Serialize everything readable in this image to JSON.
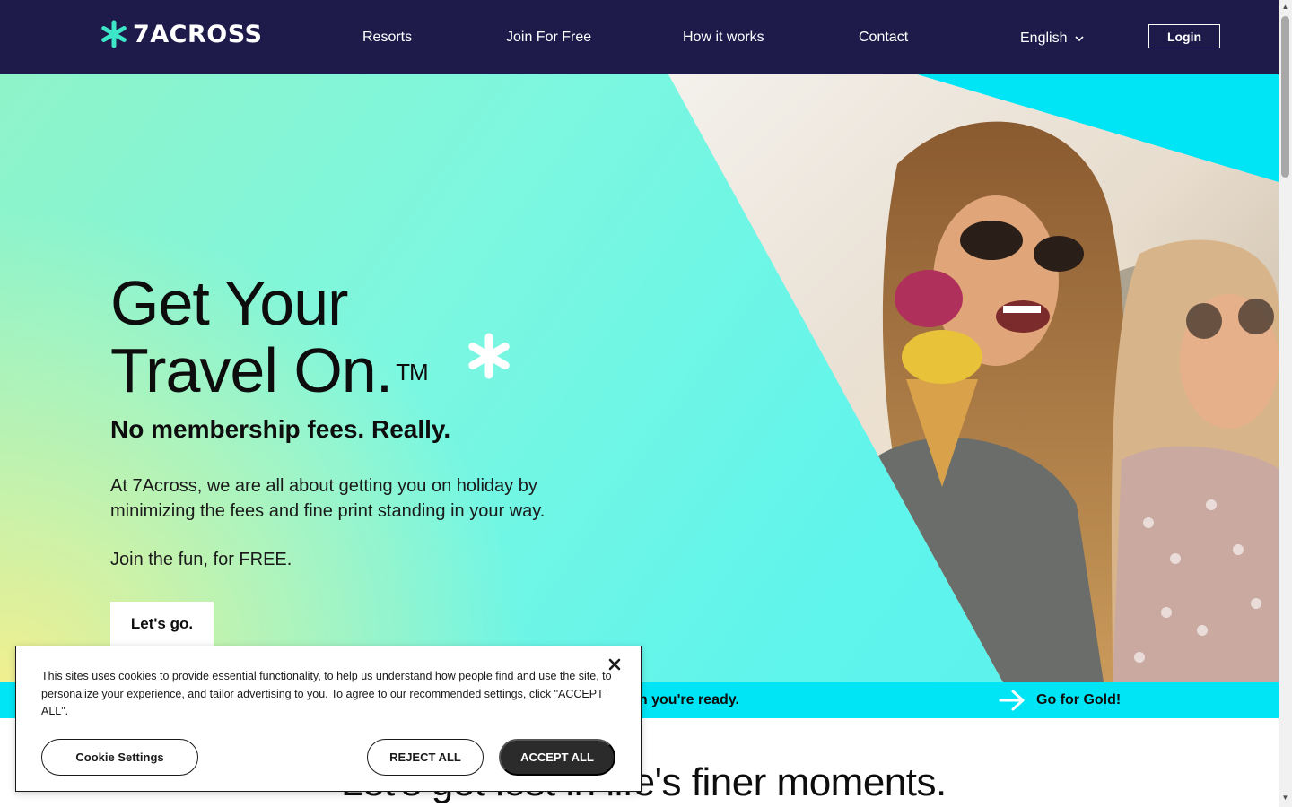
{
  "header": {
    "logo_text": "7ACROSS",
    "nav": [
      {
        "label": "Resorts"
      },
      {
        "label": "Join For Free"
      },
      {
        "label": "How it works"
      },
      {
        "label": "Contact"
      }
    ],
    "language": "English",
    "login_label": "Login"
  },
  "hero": {
    "title_line1": "Get Your",
    "title_line2": "Travel On.",
    "trademark": "TM",
    "subtitle": "No membership fees. Really.",
    "description": "At 7Across, we are all about getting you on holiday by minimizing the fees and fine print standing in your way.",
    "join_text": "Join the fun, for FREE.",
    "cta_label": "Let's go."
  },
  "strip": {
    "partial_text": "en you're ready.",
    "gold_label": "Go for Gold!"
  },
  "section": {
    "title_partial": "Let's get lost in life's finer moments."
  },
  "cookie": {
    "text": "This sites uses cookies to provide essential functionality, to help us understand how people find and use the site, to personalize your experience, and tailor advertising to you. To agree to our recommended settings, click \"ACCEPT ALL\".",
    "settings_label": "Cookie Settings",
    "reject_label": "REJECT ALL",
    "accept_label": "ACCEPT ALL"
  },
  "colors": {
    "header_bg": "#1e1b4b",
    "accent_cyan": "#00e5f5",
    "brand_teal": "#3ee6c8"
  }
}
